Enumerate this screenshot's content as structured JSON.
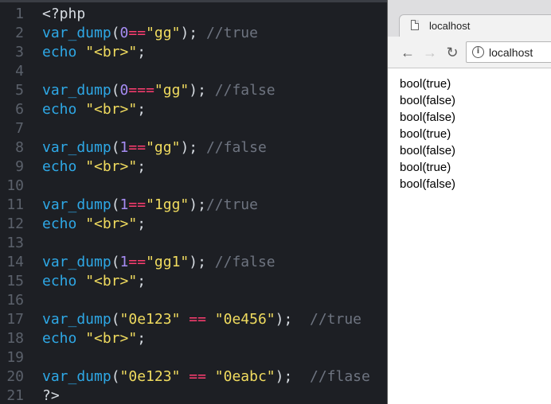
{
  "editor": {
    "lines": [
      {
        "n": "1",
        "tokens": [
          [
            "plain",
            "<?php"
          ]
        ]
      },
      {
        "n": "2",
        "tokens": [
          [
            "kw",
            "var_dump"
          ],
          [
            "plain",
            "("
          ],
          [
            "num",
            "0"
          ],
          [
            "op",
            "=="
          ],
          [
            "str",
            "\"gg\""
          ],
          [
            "plain",
            "); "
          ],
          [
            "cm",
            "//true"
          ]
        ]
      },
      {
        "n": "3",
        "tokens": [
          [
            "kw",
            "echo"
          ],
          [
            "plain",
            " "
          ],
          [
            "str",
            "\"<br>\""
          ],
          [
            "plain",
            ";"
          ]
        ]
      },
      {
        "n": "4",
        "tokens": []
      },
      {
        "n": "5",
        "tokens": [
          [
            "kw",
            "var_dump"
          ],
          [
            "plain",
            "("
          ],
          [
            "num",
            "0"
          ],
          [
            "op",
            "==="
          ],
          [
            "str",
            "\"gg\""
          ],
          [
            "plain",
            "); "
          ],
          [
            "cm",
            "//false"
          ]
        ]
      },
      {
        "n": "6",
        "tokens": [
          [
            "kw",
            "echo"
          ],
          [
            "plain",
            " "
          ],
          [
            "str",
            "\"<br>\""
          ],
          [
            "plain",
            ";"
          ]
        ]
      },
      {
        "n": "7",
        "tokens": []
      },
      {
        "n": "8",
        "tokens": [
          [
            "kw",
            "var_dump"
          ],
          [
            "plain",
            "("
          ],
          [
            "num",
            "1"
          ],
          [
            "op",
            "=="
          ],
          [
            "str",
            "\"gg\""
          ],
          [
            "plain",
            "); "
          ],
          [
            "cm",
            "//false"
          ]
        ]
      },
      {
        "n": "9",
        "tokens": [
          [
            "kw",
            "echo"
          ],
          [
            "plain",
            " "
          ],
          [
            "str",
            "\"<br>\""
          ],
          [
            "plain",
            ";"
          ]
        ]
      },
      {
        "n": "10",
        "tokens": []
      },
      {
        "n": "11",
        "tokens": [
          [
            "kw",
            "var_dump"
          ],
          [
            "plain",
            "("
          ],
          [
            "num",
            "1"
          ],
          [
            "op",
            "=="
          ],
          [
            "str",
            "\"1gg\""
          ],
          [
            "plain",
            ");"
          ],
          [
            "cm",
            "//true"
          ]
        ]
      },
      {
        "n": "12",
        "tokens": [
          [
            "kw",
            "echo"
          ],
          [
            "plain",
            " "
          ],
          [
            "str",
            "\"<br>\""
          ],
          [
            "plain",
            ";"
          ]
        ]
      },
      {
        "n": "13",
        "tokens": []
      },
      {
        "n": "14",
        "tokens": [
          [
            "kw",
            "var_dump"
          ],
          [
            "plain",
            "("
          ],
          [
            "num",
            "1"
          ],
          [
            "op",
            "=="
          ],
          [
            "str",
            "\"gg1\""
          ],
          [
            "plain",
            "); "
          ],
          [
            "cm",
            "//false"
          ]
        ]
      },
      {
        "n": "15",
        "tokens": [
          [
            "kw",
            "echo"
          ],
          [
            "plain",
            " "
          ],
          [
            "str",
            "\"<br>\""
          ],
          [
            "plain",
            ";"
          ]
        ]
      },
      {
        "n": "16",
        "tokens": []
      },
      {
        "n": "17",
        "tokens": [
          [
            "kw",
            "var_dump"
          ],
          [
            "plain",
            "("
          ],
          [
            "str",
            "\"0e123\""
          ],
          [
            "plain",
            " "
          ],
          [
            "op",
            "=="
          ],
          [
            "plain",
            " "
          ],
          [
            "str",
            "\"0e456\""
          ],
          [
            "plain",
            ");  "
          ],
          [
            "cm",
            "//true"
          ]
        ]
      },
      {
        "n": "18",
        "tokens": [
          [
            "kw",
            "echo"
          ],
          [
            "plain",
            " "
          ],
          [
            "str",
            "\"<br>\""
          ],
          [
            "plain",
            ";"
          ]
        ]
      },
      {
        "n": "19",
        "tokens": []
      },
      {
        "n": "20",
        "tokens": [
          [
            "kw",
            "var_dump"
          ],
          [
            "plain",
            "("
          ],
          [
            "str",
            "\"0e123\""
          ],
          [
            "plain",
            " "
          ],
          [
            "op",
            "=="
          ],
          [
            "plain",
            " "
          ],
          [
            "str",
            "\"0eabc\""
          ],
          [
            "plain",
            ");  "
          ],
          [
            "cm",
            "//flase"
          ]
        ]
      },
      {
        "n": "21",
        "tokens": [
          [
            "plain",
            "?>"
          ]
        ]
      }
    ]
  },
  "browser": {
    "tab_title": "localhost",
    "url": "localhost",
    "icons": {
      "back": "back-arrow-icon",
      "forward": "forward-arrow-icon",
      "reload": "reload-icon",
      "info": "info-icon",
      "page": "page-icon"
    },
    "output": [
      "bool(true)",
      "bool(false)",
      "bool(false)",
      "bool(true)",
      "bool(false)",
      "bool(true)",
      "bool(false)"
    ]
  }
}
